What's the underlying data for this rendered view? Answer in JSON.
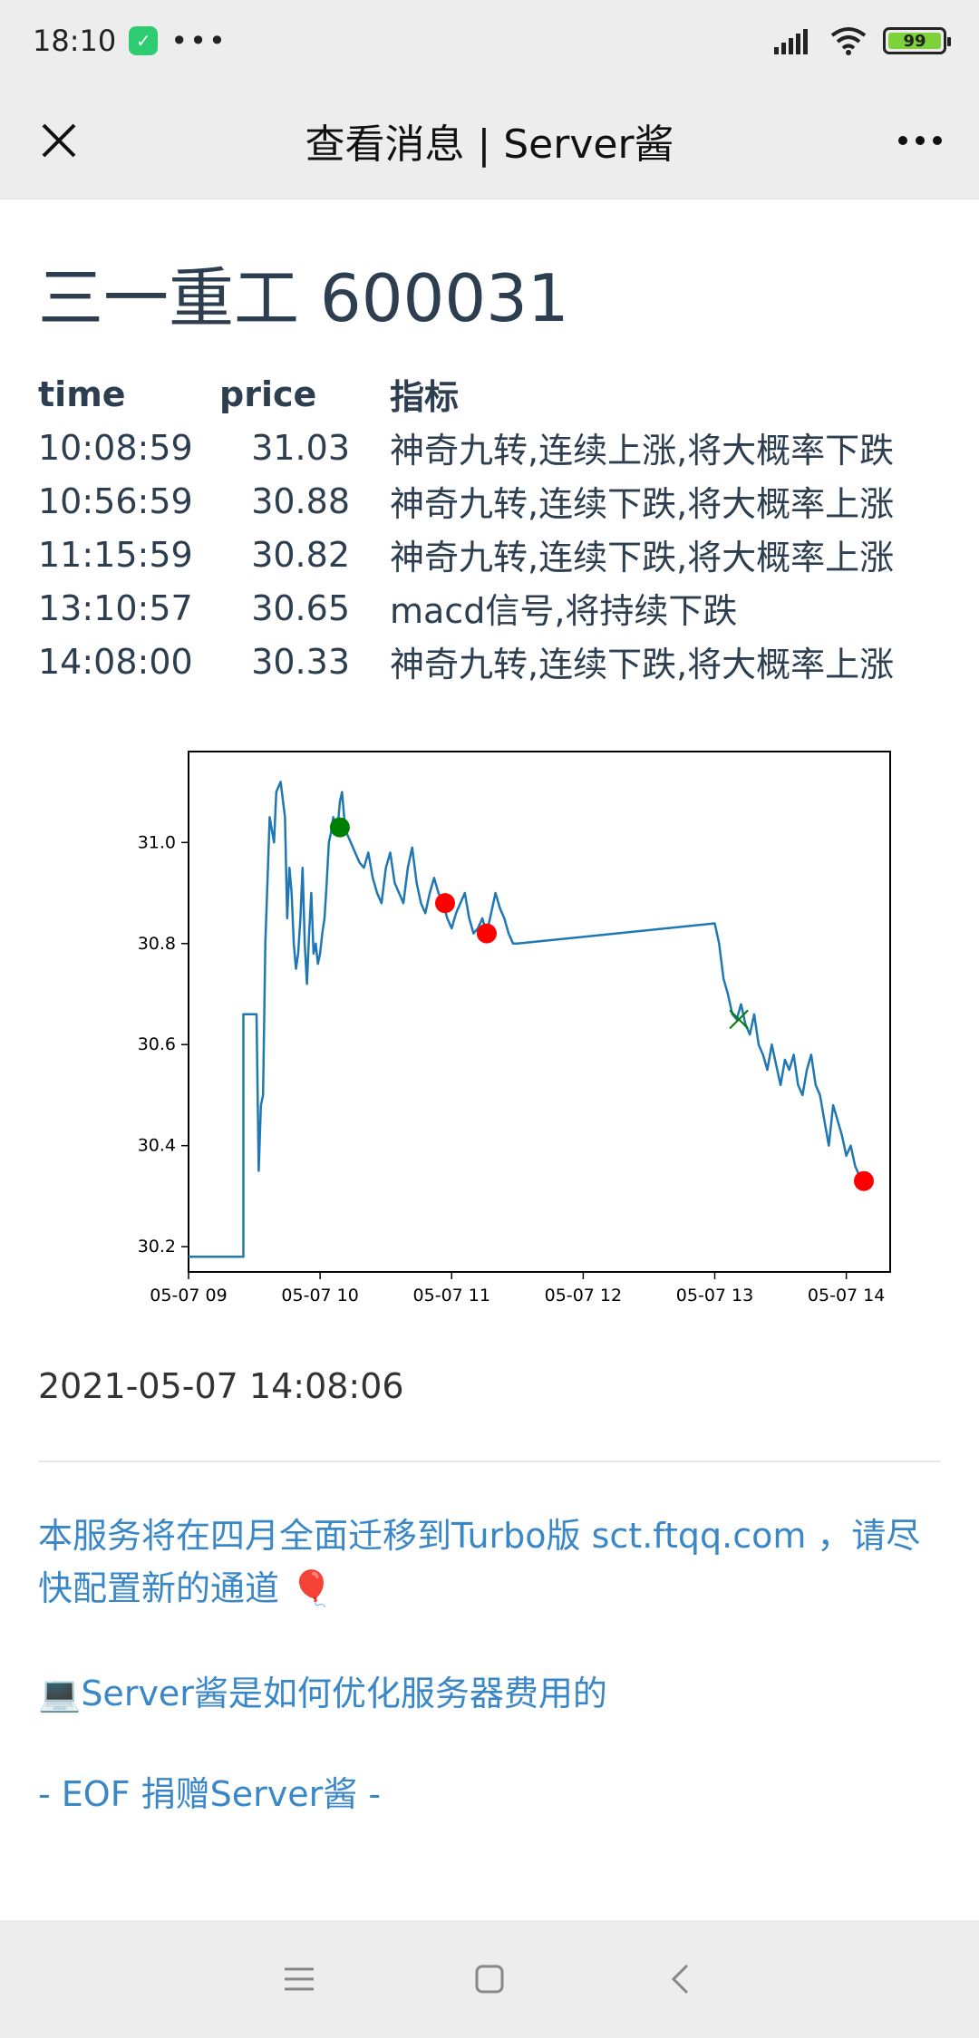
{
  "status_bar": {
    "time": "18:10",
    "more": "•••",
    "battery": "99"
  },
  "nav": {
    "title": "查看消息 | Server酱"
  },
  "message": {
    "title": "三一重工 600031",
    "table": {
      "headers": [
        "time",
        "price",
        "指标"
      ],
      "rows": [
        [
          "10:08:59",
          "31.03",
          "神奇九转,连续上涨,将大概率下跌"
        ],
        [
          "10:56:59",
          "30.88",
          "神奇九转,连续下跌,将大概率上涨"
        ],
        [
          "11:15:59",
          "30.82",
          "神奇九转,连续下跌,将大概率上涨"
        ],
        [
          "13:10:57",
          "30.65",
          "macd信号,将持续下跌"
        ],
        [
          "14:08:00",
          "30.33",
          "神奇九转,连续下跌,将大概率上涨"
        ]
      ]
    },
    "timestamp": "2021-05-07 14:08:06",
    "notice": "本服务将在四月全面迁移到Turbo版 sct.ftqq.com ，请尽快配置新的通道 🎈",
    "link": "💻Server酱是如何优化服务器费用的",
    "eof": "- EOF 捐赠Server酱 -"
  },
  "chart_data": {
    "type": "line",
    "ylim": [
      30.15,
      31.18
    ],
    "xlim": [
      "09:00",
      "14:20"
    ],
    "x_ticks": [
      "05-07 09",
      "05-07 10",
      "05-07 11",
      "05-07 12",
      "05-07 13",
      "05-07 14"
    ],
    "y_ticks": [
      "30.2",
      "30.4",
      "30.6",
      "30.8",
      "31.0"
    ],
    "line_color": "#1f77b4",
    "series": [
      {
        "x": [
          "09:00",
          "09:15",
          "09:25",
          "09:25",
          "09:30",
          "09:31",
          "09:32",
          "09:33",
          "09:34",
          "09:35",
          "09:37",
          "09:39",
          "09:40",
          "09:42",
          "09:44",
          "09:45",
          "09:46",
          "09:47",
          "09:48",
          "09:49",
          "09:50",
          "09:51",
          "09:52",
          "09:53",
          "09:54",
          "09:55",
          "09:56",
          "09:57",
          "09:58",
          "09:59",
          "10:00",
          "10:01",
          "10:02",
          "10:03",
          "10:04",
          "10:05",
          "10:06",
          "10:07",
          "10:08",
          "10:09",
          "10:10",
          "10:11",
          "10:12",
          "10:14",
          "10:16",
          "10:18",
          "10:20",
          "10:22",
          "10:24",
          "10:26",
          "10:28",
          "10:30",
          "10:32",
          "10:34",
          "10:36",
          "10:38",
          "10:40",
          "10:42",
          "10:44",
          "10:46",
          "10:48",
          "10:50",
          "10:52",
          "10:54",
          "10:56",
          "10:58",
          "11:00",
          "11:02",
          "11:04",
          "11:06",
          "11:08",
          "11:10",
          "11:12",
          "11:14",
          "11:16",
          "11:18",
          "11:20",
          "11:22",
          "11:24",
          "11:26",
          "11:28",
          "11:30",
          "13:00",
          "13:02",
          "13:04",
          "13:06",
          "13:08",
          "13:10",
          "13:12",
          "13:14",
          "13:16",
          "13:18",
          "13:20",
          "13:22",
          "13:24",
          "13:26",
          "13:28",
          "13:30",
          "13:32",
          "13:34",
          "13:36",
          "13:38",
          "13:40",
          "13:42",
          "13:44",
          "13:46",
          "13:48",
          "13:50",
          "13:52",
          "13:54",
          "13:56",
          "13:58",
          "14:00",
          "14:02",
          "14:04",
          "14:06",
          "14:08"
        ],
        "y": [
          30.18,
          30.18,
          30.18,
          30.66,
          30.66,
          30.66,
          30.35,
          30.48,
          30.5,
          30.8,
          31.05,
          31.0,
          31.1,
          31.12,
          31.05,
          30.85,
          30.95,
          30.9,
          30.8,
          30.75,
          30.78,
          30.85,
          30.95,
          30.8,
          30.72,
          30.82,
          30.9,
          30.78,
          30.8,
          30.76,
          30.78,
          30.82,
          30.85,
          30.92,
          31.0,
          31.02,
          31.05,
          31.03,
          31.03,
          31.08,
          31.1,
          31.05,
          31.02,
          31.0,
          30.98,
          30.96,
          30.95,
          30.98,
          30.93,
          30.9,
          30.88,
          30.95,
          30.98,
          30.92,
          30.9,
          30.88,
          30.95,
          30.99,
          30.92,
          30.88,
          30.86,
          30.9,
          30.93,
          30.9,
          30.88,
          30.85,
          30.83,
          30.86,
          30.88,
          30.9,
          30.85,
          30.82,
          30.83,
          30.85,
          30.82,
          30.86,
          30.9,
          30.87,
          30.85,
          30.82,
          30.8,
          30.8,
          30.84,
          30.8,
          30.73,
          30.7,
          30.66,
          30.65,
          30.68,
          30.64,
          30.62,
          30.66,
          30.6,
          30.58,
          30.55,
          30.6,
          30.56,
          30.52,
          30.57,
          30.55,
          30.58,
          30.52,
          30.5,
          30.55,
          30.58,
          30.52,
          30.5,
          30.45,
          30.4,
          30.48,
          30.45,
          30.42,
          30.38,
          30.4,
          30.36,
          30.34,
          30.33
        ]
      }
    ],
    "markers": [
      {
        "x": "10:09",
        "y": 31.03,
        "color": "#008000",
        "shape": "circle"
      },
      {
        "x": "10:57",
        "y": 30.88,
        "color": "#ff0000",
        "shape": "circle"
      },
      {
        "x": "11:16",
        "y": 30.82,
        "color": "#ff0000",
        "shape": "circle"
      },
      {
        "x": "13:11",
        "y": 30.65,
        "color": "#008000",
        "shape": "x"
      },
      {
        "x": "14:08",
        "y": 30.33,
        "color": "#ff0000",
        "shape": "circle"
      }
    ]
  }
}
